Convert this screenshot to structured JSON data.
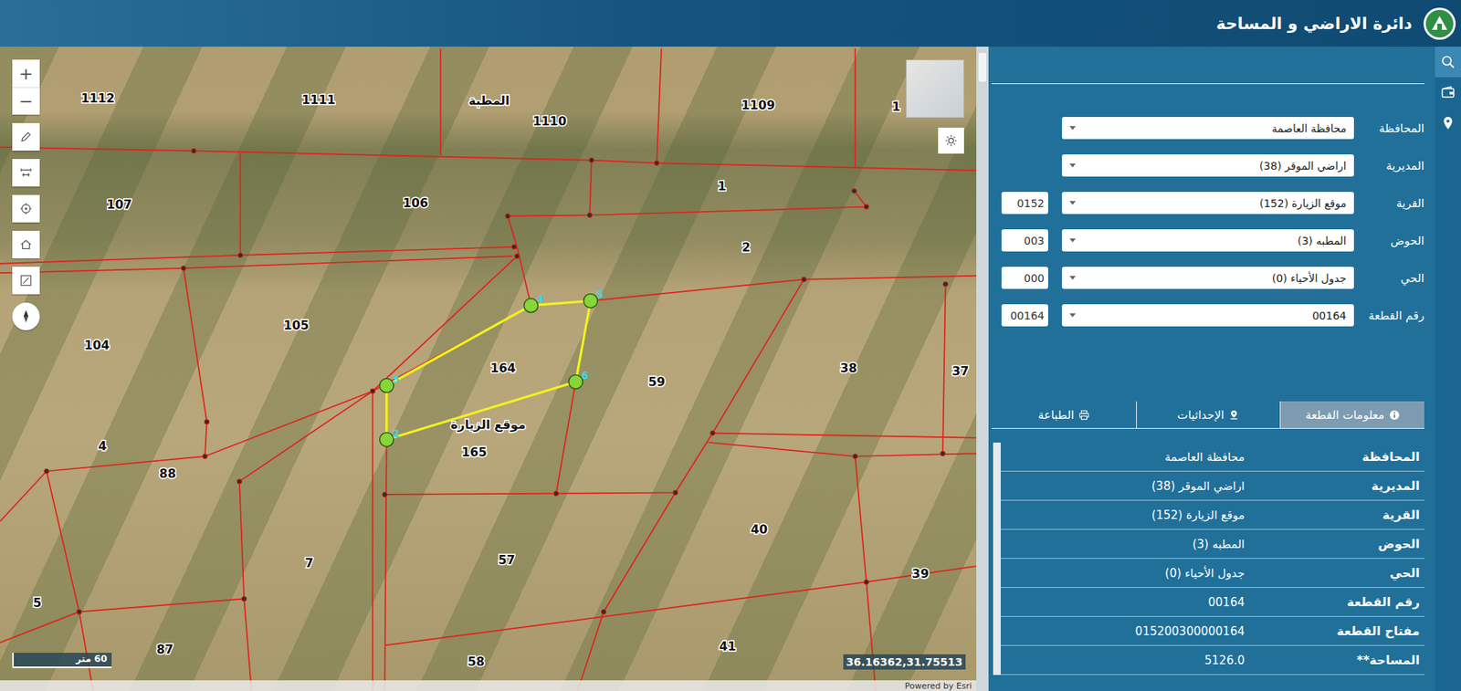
{
  "header": {
    "title": "دائرة الاراضي و المساحة"
  },
  "map": {
    "zoom": [
      "+",
      "−"
    ],
    "labels": [
      "1112",
      "1111",
      "المطبة",
      "1110",
      "1109",
      "1",
      "107",
      "106",
      "1",
      "2",
      "105",
      "104",
      "164",
      "59",
      "38",
      "37",
      "موقع الزيارة",
      "165",
      "4",
      "88",
      "7",
      "57",
      "40",
      "39",
      "5",
      "87",
      "58",
      "41"
    ],
    "boundary_points": [
      "2",
      "3",
      "4",
      "5",
      "6"
    ],
    "scale": "60 متر",
    "coordinates": "36.16362,31.75513",
    "attribution": "Powered by Esri"
  },
  "search_form": {
    "fields": [
      {
        "label": "المحافظة",
        "value": "محافظة العاصمة",
        "kind": "select"
      },
      {
        "label": "المديرية",
        "value": "اراضي الموقر (38)",
        "kind": "select"
      },
      {
        "label": "القرية",
        "value": "موقع الزيارة (152)",
        "code": "0152",
        "kind": "coded"
      },
      {
        "label": "الحوض",
        "value": "المطبه (3)",
        "code": "003",
        "kind": "coded"
      },
      {
        "label": "الحي",
        "value": "جدول الأحياء (0)",
        "code": "000",
        "kind": "coded"
      },
      {
        "label": "رقم القطعة",
        "value": "00164",
        "code": "00164",
        "kind": "coded"
      }
    ]
  },
  "tabs": [
    {
      "label": "معلومات القطعة",
      "selected": true
    },
    {
      "label": "الإحداثيات",
      "selected": false
    },
    {
      "label": "الطباعة",
      "selected": false
    }
  ],
  "info": [
    {
      "label": "المحافظة",
      "value": "محافظة العاصمة"
    },
    {
      "label": "المديرية",
      "value": "اراضي الموقر (38)"
    },
    {
      "label": "القرية",
      "value": "موقع الزيارة (152)"
    },
    {
      "label": "الحوض",
      "value": "المطبه (3)"
    },
    {
      "label": "الحي",
      "value": "جدول الأحياء (0)"
    },
    {
      "label": "رقم القطعة",
      "value": "00164"
    },
    {
      "label": "مفتاح القطعة",
      "value": "015200300000164"
    },
    {
      "label": "المساحة**",
      "value": "5126.0"
    }
  ],
  "side_nav": [
    {
      "selected": true
    },
    {
      "selected": false
    },
    {
      "selected": false
    }
  ]
}
